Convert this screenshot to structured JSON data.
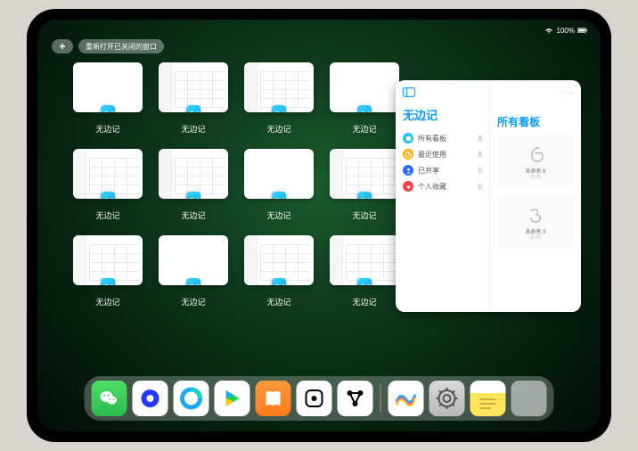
{
  "status": {
    "battery_text": "100%"
  },
  "top": {
    "add_label": "+",
    "reopen_label": "重新打开已关闭的窗口"
  },
  "app_switcher": {
    "items": [
      {
        "label": "无边记",
        "variant": "blank"
      },
      {
        "label": "无边记",
        "variant": "grid"
      },
      {
        "label": "无边记",
        "variant": "grid"
      },
      {
        "label": "无边记",
        "variant": "blank"
      },
      {
        "label": "无边记",
        "variant": "grid"
      },
      {
        "label": "无边记",
        "variant": "grid"
      },
      {
        "label": "无边记",
        "variant": "blank"
      },
      {
        "label": "无边记",
        "variant": "grid"
      },
      {
        "label": "无边记",
        "variant": "grid"
      },
      {
        "label": "无边记",
        "variant": "blank"
      },
      {
        "label": "无边记",
        "variant": "grid"
      },
      {
        "label": "无边记",
        "variant": "grid"
      }
    ]
  },
  "panel": {
    "title": "无边记",
    "subtitle": "所有看板",
    "categories": [
      {
        "icon": "square",
        "color": "#22c3ff",
        "label": "所有看板",
        "count": "8"
      },
      {
        "icon": "clock",
        "color": "#ffb300",
        "label": "最近使用",
        "count": "8"
      },
      {
        "icon": "person",
        "color": "#2d6bff",
        "label": "已共享",
        "count": "0"
      },
      {
        "icon": "heart",
        "color": "#ff4040",
        "label": "个人收藏",
        "count": "0"
      }
    ],
    "boards": [
      {
        "name": "未命名 6",
        "meta": "11:25",
        "doodle": "6"
      },
      {
        "name": "未命名 3",
        "meta": "11:25",
        "doodle": "3"
      }
    ]
  },
  "dock": {
    "items": [
      {
        "name": "wechat"
      },
      {
        "name": "quark"
      },
      {
        "name": "qq-browser"
      },
      {
        "name": "play-video"
      },
      {
        "name": "books"
      },
      {
        "name": "dice"
      },
      {
        "name": "graph"
      },
      {
        "name": "freeform"
      },
      {
        "name": "settings"
      },
      {
        "name": "notes"
      },
      {
        "name": "recent-apps"
      }
    ]
  },
  "colors": {
    "accent": "#0a99ff"
  }
}
